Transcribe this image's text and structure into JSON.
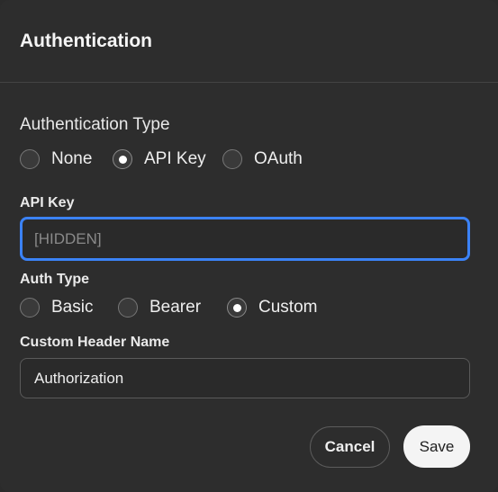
{
  "dialog": {
    "title": "Authentication"
  },
  "auth_type_section": {
    "label": "Authentication Type",
    "options": [
      {
        "label": "None",
        "checked": false
      },
      {
        "label": "API Key",
        "checked": true
      },
      {
        "label": "OAuth",
        "checked": false
      }
    ]
  },
  "api_key": {
    "label": "API Key",
    "placeholder": "[HIDDEN]"
  },
  "auth_type": {
    "label": "Auth Type",
    "options": [
      {
        "label": "Basic",
        "checked": false
      },
      {
        "label": "Bearer",
        "checked": false
      },
      {
        "label": "Custom",
        "checked": true
      }
    ]
  },
  "custom_header": {
    "label": "Custom Header Name",
    "value": "Authorization"
  },
  "buttons": {
    "cancel": "Cancel",
    "save": "Save"
  },
  "colors": {
    "focus_accent": "#3b82f6",
    "background": "#2d2d2d"
  }
}
